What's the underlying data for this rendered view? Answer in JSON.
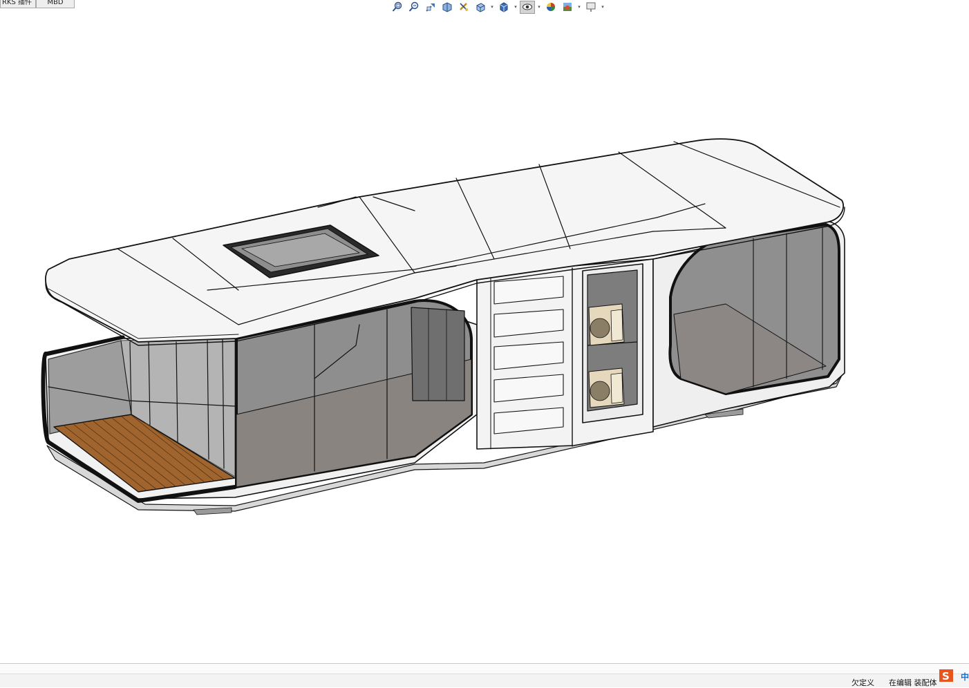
{
  "tabs": [
    {
      "label": "RKS 插件"
    },
    {
      "label": "MBD"
    }
  ],
  "toolbar": {
    "icons": [
      "zoom-to-fit-icon",
      "zoom-area-icon",
      "previous-view-icon",
      "section-view-icon",
      "dynamic-annotation-icon",
      "view-orientation-icon",
      "display-style-icon",
      "hide-show-items-icon",
      "edit-appearance-icon",
      "apply-scene-icon",
      "view-settings-icon"
    ]
  },
  "status": {
    "definition": "欠定义",
    "editing": "在编辑 装配体",
    "ime_label": "中"
  },
  "colors": {
    "background": "#ffffff",
    "body_white": "#f4f4f4",
    "glass": "#8e8e8e",
    "floor": "#8c8784",
    "deck_wood": "#a0652f",
    "outline": "#111111"
  }
}
